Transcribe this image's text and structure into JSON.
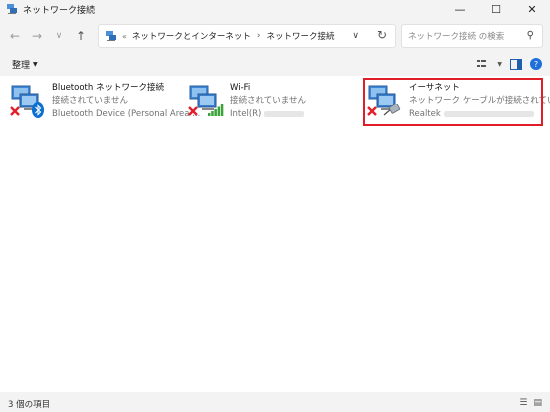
{
  "window": {
    "title": "ネットワーク接続",
    "icon": "network-connections-icon"
  },
  "address": {
    "overflow": "«",
    "crumbs": [
      "ネットワークとインターネット",
      "ネットワーク接続"
    ]
  },
  "search": {
    "placeholder": "ネットワーク接続 の検索"
  },
  "toolbar": {
    "organize_label": "整理"
  },
  "items": [
    {
      "name": "Bluetooth ネットワーク接続",
      "status": "接続されていません",
      "device": "Bluetooth Device (Personal Area ...",
      "badge": "bluetooth-icon"
    },
    {
      "name": "Wi-Fi",
      "status": "接続されていません",
      "device": "Intel(R)",
      "badge": "wifi-signal-icon"
    },
    {
      "name": "イーサネット",
      "status": "ネットワーク ケーブルが接続されていま...",
      "device": "Realtek",
      "badge": "ethernet-cable-icon"
    }
  ],
  "statusbar": {
    "count_text": "3 個の項目"
  },
  "colors": {
    "highlight": "#e01e28",
    "disconnect_x": "#e0202a",
    "bluetooth": "#0a6fd0",
    "wifi": "#3aa33a"
  }
}
